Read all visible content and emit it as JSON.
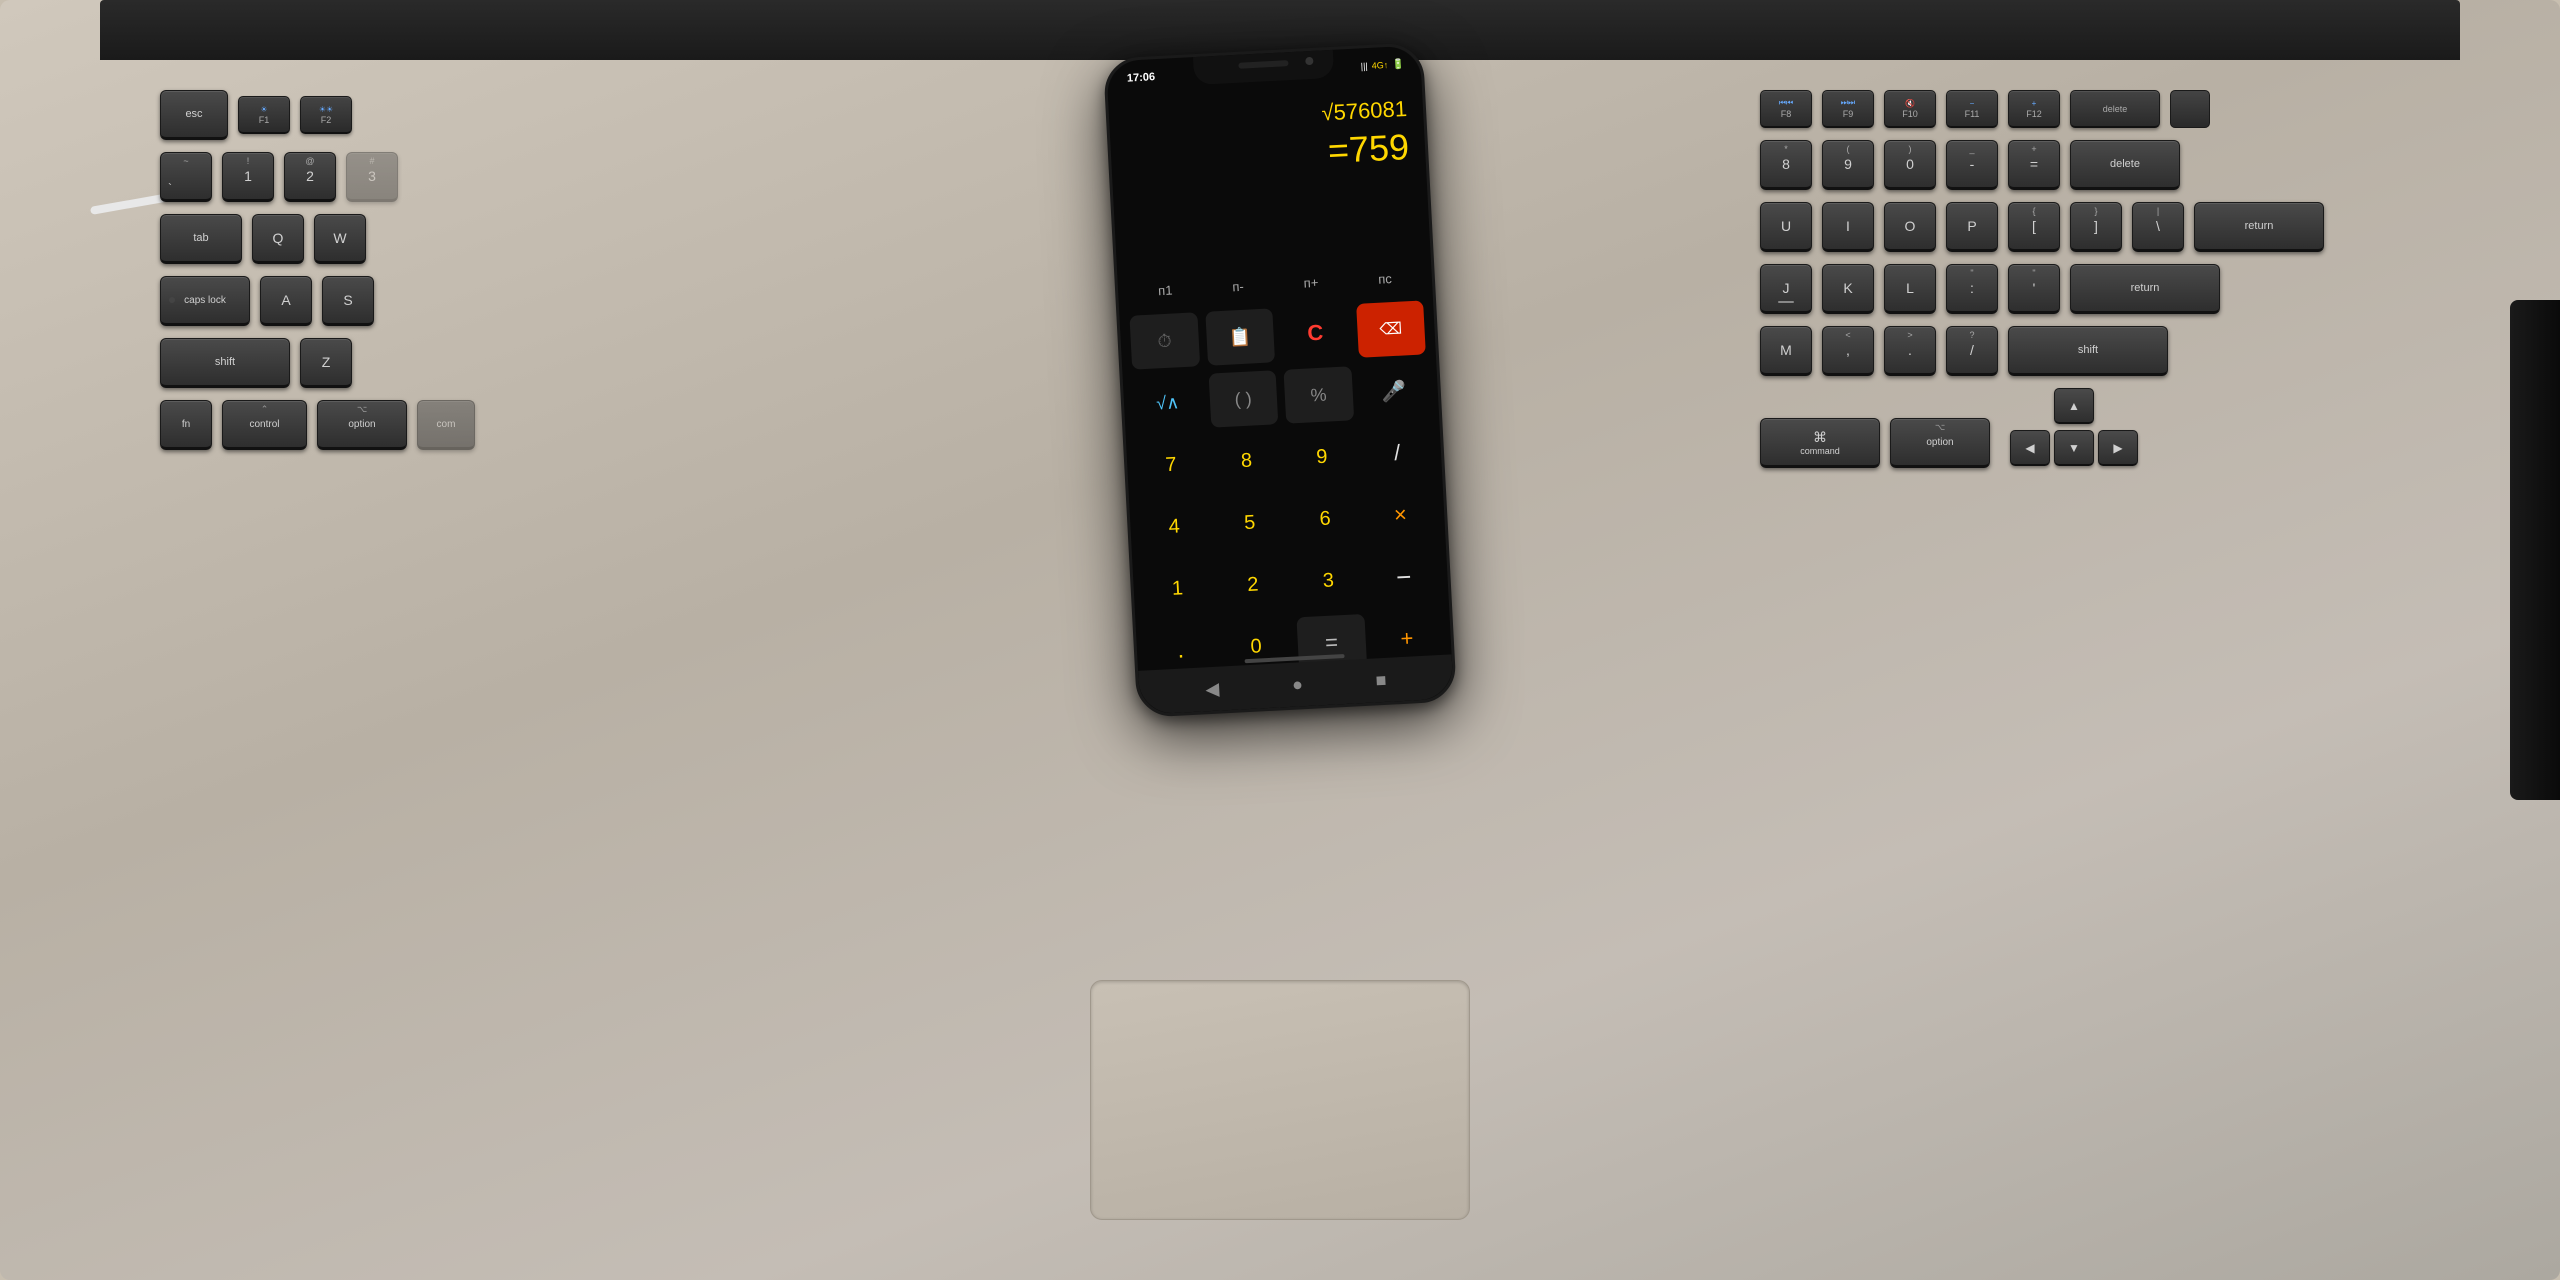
{
  "scene": {
    "background_color": "#c0b8a8",
    "description": "MacBook keyboard with Android phone showing calculator app"
  },
  "phone": {
    "status_bar": {
      "time": "17:06",
      "signal": "4G",
      "battery": "▐"
    },
    "calculator": {
      "expression": "√576081",
      "result": "=759",
      "mode_buttons": [
        "п1",
        "п-",
        "п+",
        "пс"
      ],
      "buttons": [
        {
          "label": "⏱",
          "type": "utility"
        },
        {
          "label": "📋",
          "type": "utility"
        },
        {
          "label": "C",
          "type": "red"
        },
        {
          "label": "⌫",
          "type": "backspace"
        },
        {
          "label": "√∧",
          "type": "blue"
        },
        {
          "label": "()",
          "type": "utility"
        },
        {
          "label": "%",
          "type": "utility"
        },
        {
          "label": "🎤",
          "type": "green"
        },
        {
          "label": "7",
          "type": "num"
        },
        {
          "label": "8",
          "type": "num"
        },
        {
          "label": "9",
          "type": "num"
        },
        {
          "label": "/",
          "type": "op"
        },
        {
          "label": "4",
          "type": "num"
        },
        {
          "label": "5",
          "type": "num"
        },
        {
          "label": "6",
          "type": "num"
        },
        {
          "label": "×",
          "type": "orange"
        },
        {
          "label": "1",
          "type": "num"
        },
        {
          "label": "2",
          "type": "num"
        },
        {
          "label": "3",
          "type": "num"
        },
        {
          "label": "-",
          "type": "op"
        },
        {
          "label": ".",
          "type": "num"
        },
        {
          "label": "0",
          "type": "num"
        },
        {
          "label": "=",
          "type": "utility"
        },
        {
          "label": "+",
          "type": "orange"
        }
      ]
    },
    "nav": {
      "back": "◀",
      "home": "●",
      "recent": "■"
    }
  },
  "keyboard": {
    "left": {
      "fn_row": [
        {
          "top": "",
          "bottom": "esc"
        },
        {
          "top": "☀",
          "bottom": "F1"
        },
        {
          "top": "☀☀",
          "bottom": "F2"
        },
        {
          "top": "#",
          "bottom": "3"
        }
      ],
      "row1": [
        {
          "top": "~",
          "bottom": "`"
        },
        {
          "top": "!",
          "bottom": "1"
        },
        {
          "top": "@",
          "bottom": "2"
        },
        {
          "top": "#",
          "bottom": "3"
        }
      ],
      "row2_keys": [
        "tab",
        "Q",
        "W"
      ],
      "row3_keys": [
        "caps lock",
        "A",
        "S"
      ],
      "row4_keys": [
        "Z"
      ],
      "row5_keys": [
        "shift"
      ],
      "row6_keys": [
        "fn",
        "control",
        "option",
        "com"
      ]
    },
    "right": {
      "fn_row": [
        {
          "top": "⏮",
          "bottom": "F8"
        },
        {
          "top": "⏭",
          "bottom": "F9"
        },
        {
          "top": "🔇",
          "bottom": "F10"
        },
        {
          "top": "🔉",
          "bottom": "F11"
        },
        {
          "top": "🔊",
          "bottom": "F12"
        },
        {
          "top": "",
          "bottom": "delete"
        }
      ],
      "row1": [
        {
          "top": "",
          "bottom": "8"
        },
        {
          "top": "",
          "bottom": "9"
        },
        {
          "top": "",
          "bottom": "0"
        },
        {
          "top": "",
          "bottom": "delete"
        }
      ],
      "row2": [
        "I",
        "O",
        "P",
        "{",
        "}",
        "|"
      ],
      "row3": [
        "K",
        "L",
        ";",
        "'",
        "return"
      ],
      "row4": [
        ">",
        "?",
        "shift"
      ],
      "row5": [
        "command",
        "option"
      ],
      "arrows": [
        "▲",
        "◀",
        "▼",
        "▶"
      ]
    }
  }
}
